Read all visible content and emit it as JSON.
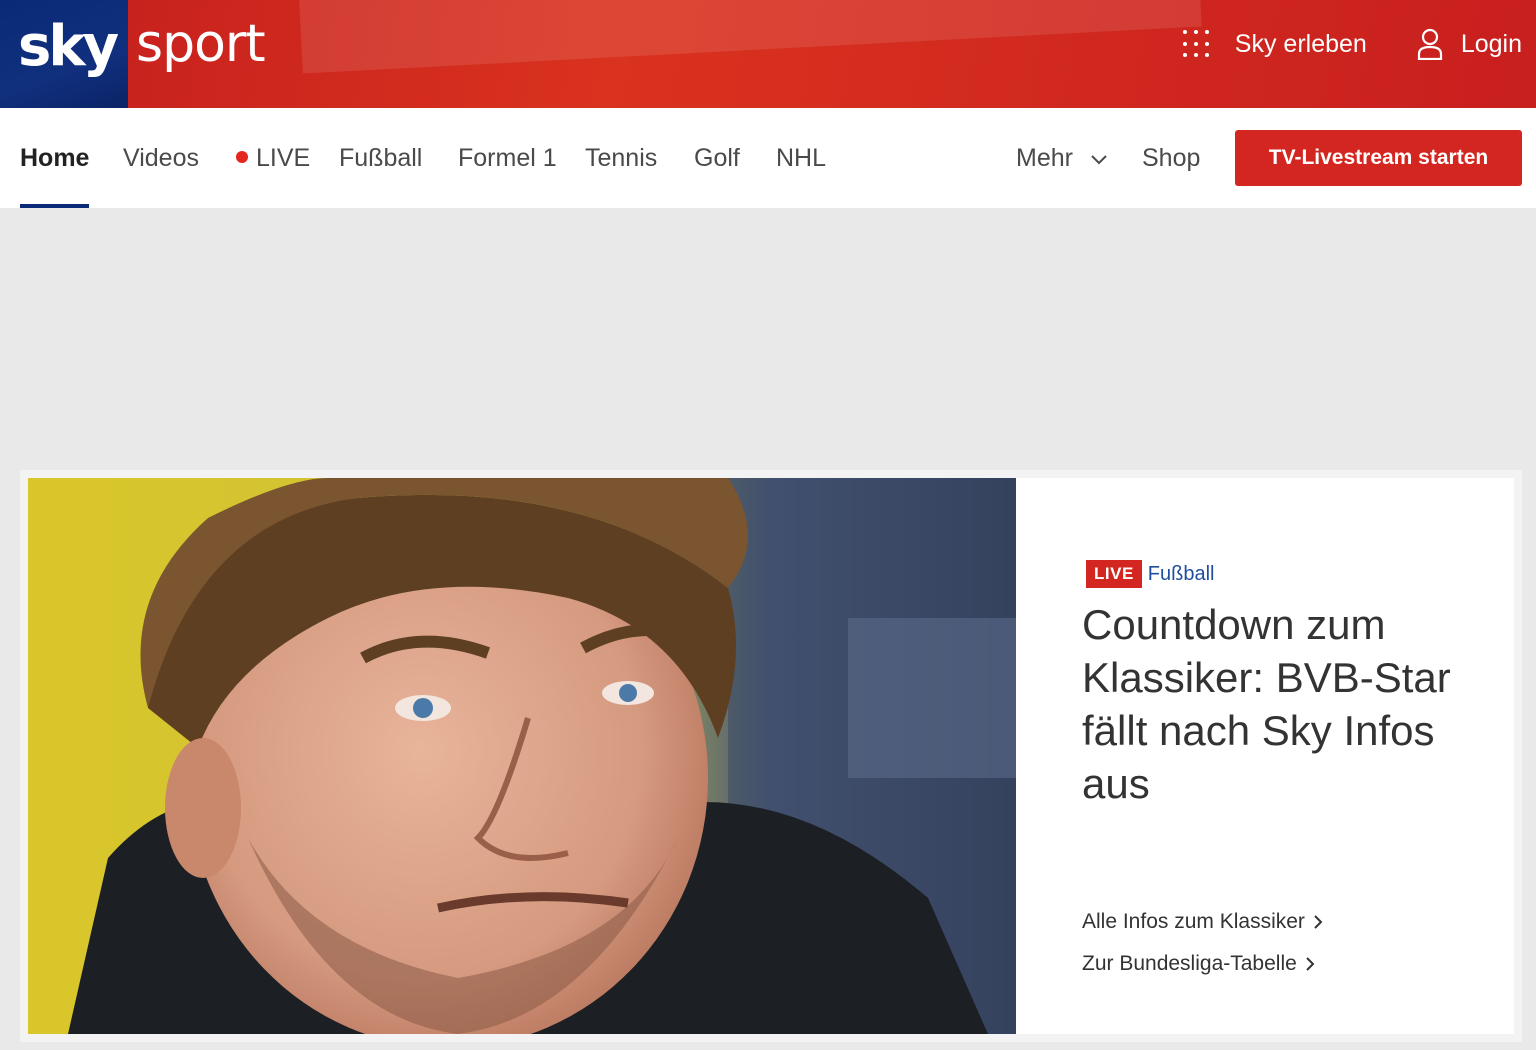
{
  "header": {
    "logo_sky": "sky",
    "logo_sport": "sport",
    "sky_erleben_label": "Sky erleben",
    "login_label": "Login"
  },
  "nav": {
    "items": [
      {
        "label": "Home",
        "active": true
      },
      {
        "label": "Videos"
      },
      {
        "label": "LIVE",
        "live": true
      },
      {
        "label": "Fußball"
      },
      {
        "label": "Formel 1"
      },
      {
        "label": "Tennis"
      },
      {
        "label": "Golf"
      },
      {
        "label": "NHL"
      }
    ],
    "more_label": "Mehr",
    "shop_label": "Shop",
    "cta_label": "TV-Livestream starten"
  },
  "hero": {
    "badge": "LIVE",
    "category": "Fußball",
    "headline": "Countdown zum Klassiker: BVB-Star fällt nach Sky Infos aus",
    "links": [
      "Alle Infos zum Klassiker",
      "Zur Bundesliga-Tabelle"
    ]
  },
  "colors": {
    "brand_red": "#d42620",
    "sky_blue": "#0a2a78",
    "category_blue": "#1f4e9e"
  }
}
